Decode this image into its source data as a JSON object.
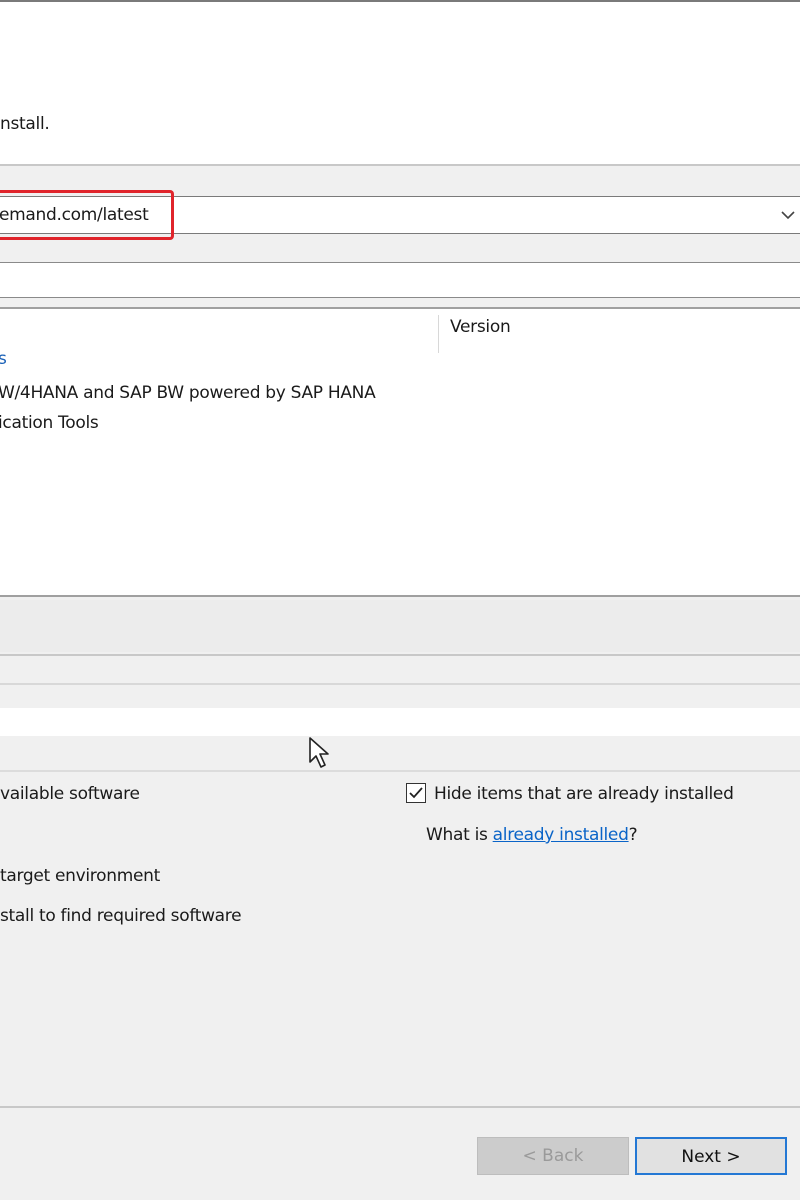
{
  "header": {
    "message_fragment": "nstall."
  },
  "site": {
    "url_fragment": "emand.com/latest",
    "dropdown_icon": "chevron-down-icon"
  },
  "table": {
    "version_header": "Version",
    "rows": [
      "s",
      "W/4HANA and SAP BW powered by SAP HANA",
      "ication Tools"
    ]
  },
  "options": {
    "left": [
      "vailable software",
      "target environment",
      "stall to find required software"
    ],
    "hide_installed_label": "Hide items that are already installed",
    "hide_installed_checked": true,
    "what_is_prefix": "What is ",
    "already_installed_link": "already installed",
    "what_is_suffix": "?"
  },
  "buttons": {
    "back": "< Back",
    "next": "Next >"
  },
  "colors": {
    "highlight_box": "#e0242b",
    "link": "#0a64c8",
    "default_button_border": "#2478d4"
  }
}
